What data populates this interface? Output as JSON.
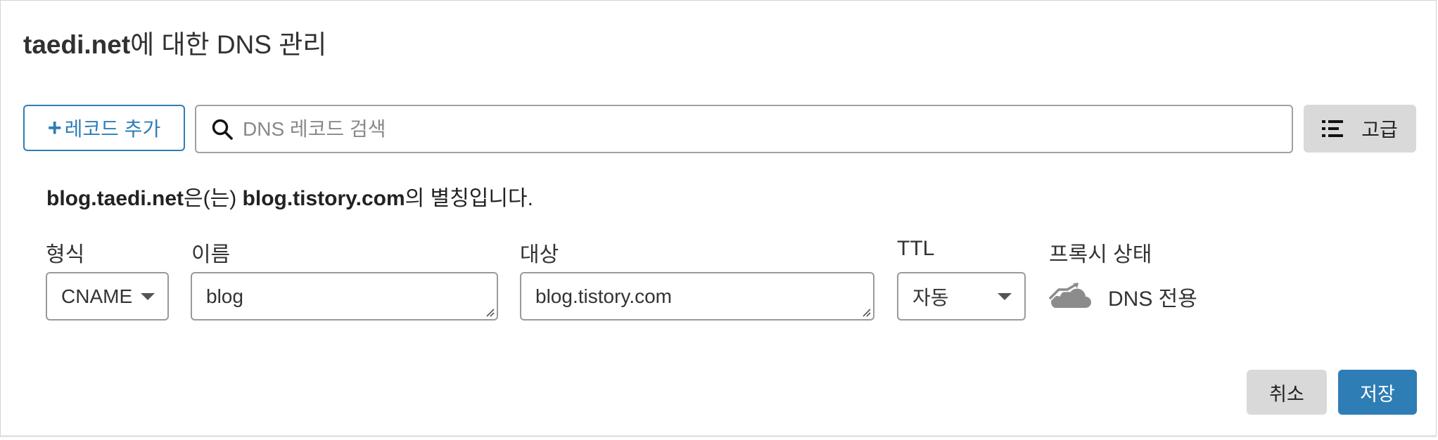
{
  "title": {
    "domain": "taedi.net",
    "suffix": "에 대한 DNS 관리"
  },
  "toolbar": {
    "add_plus": "+",
    "add_label": "레코드 추가",
    "search_placeholder": "DNS 레코드 검색",
    "search_value": "",
    "advanced_label": "고급"
  },
  "alias_notice": {
    "name": "blog.taedi.net",
    "particle": "은(는)",
    "target": "blog.tistory.com",
    "suffix": "의 별칭입니다."
  },
  "form": {
    "type_label": "형식",
    "type_value": "CNAME",
    "name_label": "이름",
    "name_value": "blog",
    "target_label": "대상",
    "target_value": "blog.tistory.com",
    "ttl_label": "TTL",
    "ttl_value": "자동",
    "proxy_label": "프록시 상태",
    "proxy_value": "DNS 전용",
    "proxy_icon": "cloud-dns-only-icon"
  },
  "actions": {
    "cancel_label": "취소",
    "save_label": "저장"
  },
  "colors": {
    "accent": "#2e7db5",
    "button_gray": "#d9d9d9",
    "icon_gray": "#8c8c8c"
  }
}
